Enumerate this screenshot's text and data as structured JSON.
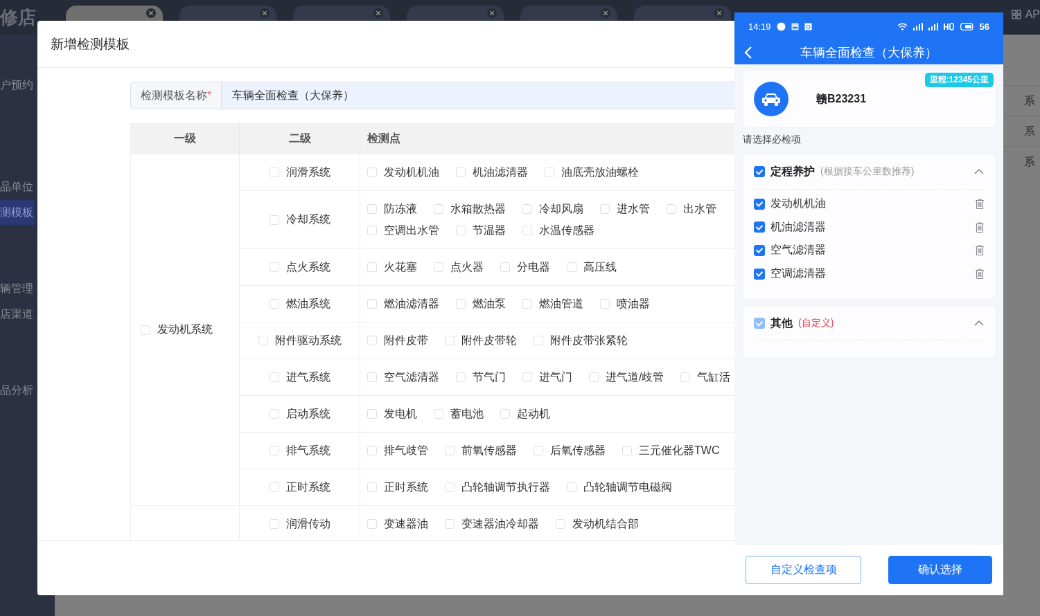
{
  "app": {
    "logo": "修店",
    "tabs": [
      {
        "selected": true
      },
      {
        "selected": false
      },
      {
        "selected": false
      },
      {
        "selected": false
      },
      {
        "selected": false
      },
      {
        "selected": false
      }
    ],
    "header_right": "AP",
    "sidebar": [
      {
        "label": "户预约",
        "selected": false
      },
      {
        "label": "品单位",
        "selected": false
      },
      {
        "label": "测模板",
        "selected": true
      },
      {
        "label": "辆管理",
        "selected": false
      },
      {
        "label": "店渠道",
        "selected": false
      },
      {
        "label": "品分析",
        "selected": false
      }
    ],
    "background_rows": [
      "系",
      "系",
      "系"
    ]
  },
  "dialog": {
    "title": "新增检测模板",
    "name_field": {
      "label": "检测模板名称",
      "required_mark": "*",
      "value": "车辆全面检查（大保养）"
    },
    "table": {
      "columns": [
        "一级",
        "二级",
        "检测点"
      ],
      "groups": [
        {
          "label": "发动机系统",
          "checked": false,
          "rows": [
            {
              "label": "润滑系统",
              "checked": false,
              "points": [
                {
                  "label": "发动机机油",
                  "checked": false
                },
                {
                  "label": "机油滤清器",
                  "checked": false
                },
                {
                  "label": "油底壳放油螺栓",
                  "checked": false
                }
              ]
            },
            {
              "label": "冷却系统",
              "checked": false,
              "points": [
                {
                  "label": "防冻液",
                  "checked": false
                },
                {
                  "label": "水箱散热器",
                  "checked": false
                },
                {
                  "label": "冷却风扇",
                  "checked": false
                },
                {
                  "label": "进水管",
                  "checked": false
                },
                {
                  "label": "出水管",
                  "checked": false
                },
                {
                  "label": "空调出水管",
                  "checked": false
                },
                {
                  "label": "节温器",
                  "checked": false
                },
                {
                  "label": "水温传感器",
                  "checked": false
                }
              ]
            },
            {
              "label": "点火系统",
              "checked": false,
              "points": [
                {
                  "label": "火花塞",
                  "checked": false
                },
                {
                  "label": "点火器",
                  "checked": false
                },
                {
                  "label": "分电器",
                  "checked": false
                },
                {
                  "label": "高压线",
                  "checked": false
                }
              ]
            },
            {
              "label": "燃油系统",
              "checked": false,
              "points": [
                {
                  "label": "燃油滤清器",
                  "checked": false
                },
                {
                  "label": "燃油泵",
                  "checked": false
                },
                {
                  "label": "燃油管道",
                  "checked": false
                },
                {
                  "label": "喷油器",
                  "checked": false
                }
              ]
            },
            {
              "label": "附件驱动系统",
              "checked": false,
              "points": [
                {
                  "label": "附件皮带",
                  "checked": false
                },
                {
                  "label": "附件皮带轮",
                  "checked": false
                },
                {
                  "label": "附件皮带张紧轮",
                  "checked": false
                }
              ]
            },
            {
              "label": "进气系统",
              "checked": false,
              "points": [
                {
                  "label": "空气滤清器",
                  "checked": false
                },
                {
                  "label": "节气门",
                  "checked": false
                },
                {
                  "label": "进气门",
                  "checked": false
                },
                {
                  "label": "进气道/歧管",
                  "checked": false
                },
                {
                  "label": "气缸活",
                  "checked": false
                }
              ]
            },
            {
              "label": "启动系统",
              "checked": false,
              "points": [
                {
                  "label": "发电机",
                  "checked": false
                },
                {
                  "label": "蓄电池",
                  "checked": false
                },
                {
                  "label": "起动机",
                  "checked": false
                }
              ]
            },
            {
              "label": "排气系统",
              "checked": false,
              "points": [
                {
                  "label": "排气歧管",
                  "checked": false
                },
                {
                  "label": "前氧传感器",
                  "checked": false
                },
                {
                  "label": "后氧传感器",
                  "checked": false
                },
                {
                  "label": "三元催化器TWC",
                  "checked": false
                }
              ]
            },
            {
              "label": "正时系统",
              "checked": false,
              "points": [
                {
                  "label": "正时系统",
                  "checked": false
                },
                {
                  "label": "凸轮轴调节执行器",
                  "checked": false
                },
                {
                  "label": "凸轮轴调节电磁阀",
                  "checked": false
                }
              ]
            }
          ]
        },
        {
          "rows": [
            {
              "label": "润滑传动",
              "checked": false,
              "points": [
                {
                  "label": "变速器油",
                  "checked": false
                },
                {
                  "label": "变速器油冷却器",
                  "checked": false
                },
                {
                  "label": "发动机结合部",
                  "checked": false
                }
              ]
            }
          ]
        }
      ]
    }
  },
  "phone": {
    "status": {
      "time": "14:19",
      "battery": "56"
    },
    "title": "车辆全面检查（大保养）",
    "vehicle": {
      "plate": "赣B23231",
      "mileage": "里程:12345公里"
    },
    "prompt": "请选择必检项",
    "sections": [
      {
        "title": "定程养护",
        "note": "(根据接车公里数推荐)",
        "kind": "recommended",
        "checked": true,
        "disabled": false,
        "expanded": true,
        "items": [
          {
            "label": "发动机机油",
            "checked": true
          },
          {
            "label": "机油滤清器",
            "checked": true
          },
          {
            "label": "空气滤清器",
            "checked": true
          },
          {
            "label": "空调滤清器",
            "checked": true
          }
        ]
      },
      {
        "title": "其他",
        "note": "(自定义)",
        "kind": "custom",
        "checked": true,
        "disabled": true,
        "expanded": true
      }
    ],
    "buttons": [
      {
        "label": "自定义检查项",
        "kind": "outline"
      },
      {
        "label": "确认选择",
        "kind": "primary"
      }
    ]
  }
}
